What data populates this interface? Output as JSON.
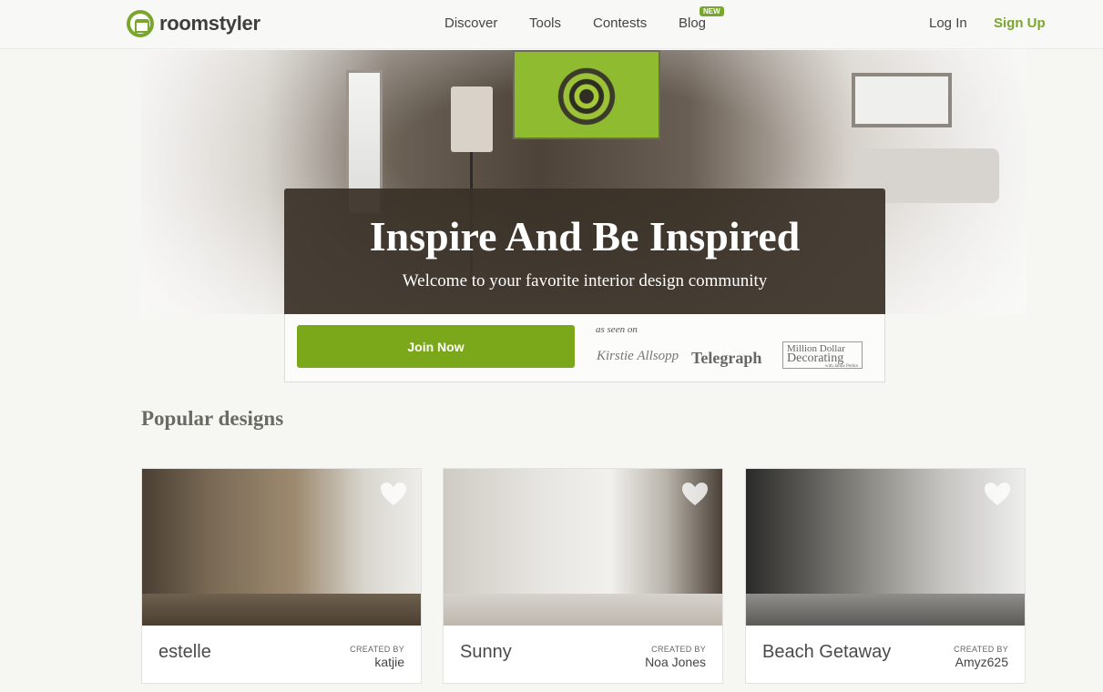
{
  "header": {
    "logo_text": "roomstyler",
    "nav": {
      "discover": "Discover",
      "tools": "Tools",
      "contests": "Contests",
      "blog": "Blog",
      "blog_badge": "NEW"
    },
    "login": "Log In",
    "signup": "Sign Up"
  },
  "hero": {
    "title": "Inspire And Be Inspired",
    "subtitle": "Welcome to your favorite interior design community",
    "join_label": "Join Now",
    "seen_on_label": "as seen on",
    "press": {
      "p1": "Kirstie Allsopp",
      "p2": "Telegraph",
      "p3_line1": "Million Dollar",
      "p3_line2": "Decorating",
      "p3_line3": "with Jamie Perkin"
    }
  },
  "popular": {
    "title": "Popular designs",
    "created_by_label": "CREATED BY",
    "cards": [
      {
        "name": "estelle",
        "author": "katjie"
      },
      {
        "name": "Sunny",
        "author": "Noa Jones"
      },
      {
        "name": "Beach Getaway",
        "author": "Amyz625"
      }
    ]
  },
  "colors": {
    "brand_green": "#7aa62d",
    "hero_overlay": "#3a3228"
  }
}
